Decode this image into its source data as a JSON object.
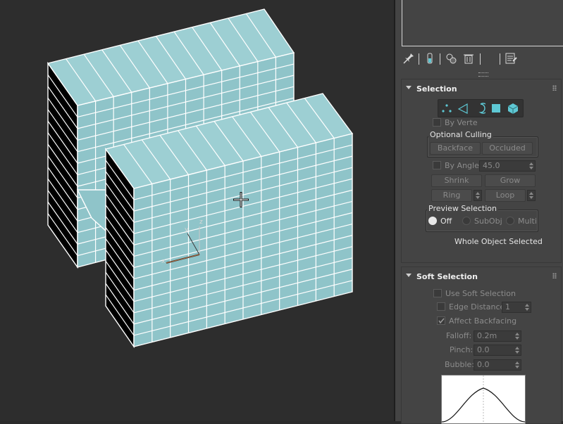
{
  "viewport": {
    "axis_labels": {
      "z": "z",
      "x": "x",
      "y": "y"
    }
  },
  "toolbar": {
    "icons": [
      "pin-icon",
      "funnel-icon",
      "configure-icon",
      "trash-icon",
      "edit-icon"
    ]
  },
  "selection": {
    "title": "Selection",
    "sub_levels": [
      "vertex-icon",
      "edge-icon",
      "border-icon",
      "polygon-icon",
      "element-icon"
    ],
    "by_vertex": "By Vertex",
    "optional_culling": {
      "title": "Optional Culling",
      "backface": "Backface",
      "occluded": "Occluded"
    },
    "by_angle": {
      "label": "By Angle:",
      "value": "45.0"
    },
    "shrink": "Shrink",
    "grow": "Grow",
    "ring": "Ring",
    "loop": "Loop",
    "preview": {
      "title": "Preview Selection",
      "options": [
        "Off",
        "SubObj",
        "Multi"
      ],
      "selected": "Off"
    },
    "status": "Whole Object Selected"
  },
  "soft_selection": {
    "title": "Soft Selection",
    "use_soft": "Use Soft Selection",
    "edge_distance": {
      "label": "Edge Distance:",
      "value": "1"
    },
    "affect_backfacing": {
      "label": "Affect Backfacing",
      "checked": true
    },
    "falloff": {
      "label": "Falloff:",
      "value": "0.2m"
    },
    "pinch": {
      "label": "Pinch:",
      "value": "0.0"
    },
    "bubble": {
      "label": "Bubble:",
      "value": "0.0"
    }
  },
  "colors": {
    "mesh_face": "#8fc4c9",
    "mesh_top": "#9dcfd3",
    "mesh_side": "#000000",
    "accent_icon": "#5ec8d4",
    "viewport_bg": "#2d2d2d",
    "panel_bg": "#444444"
  }
}
